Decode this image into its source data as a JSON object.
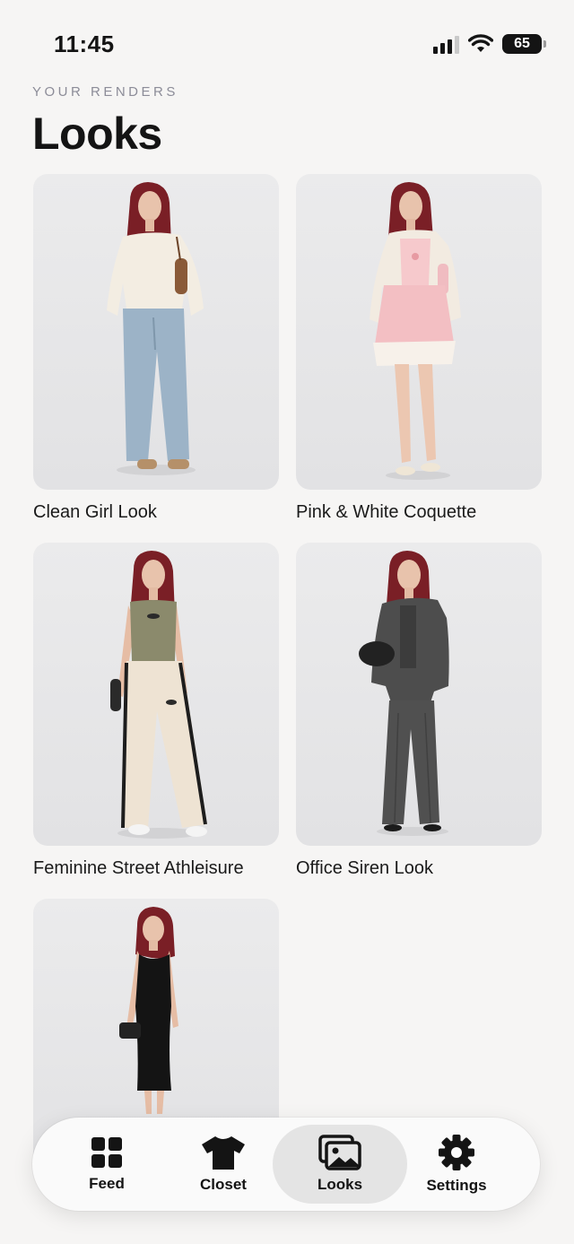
{
  "status_bar": {
    "time": "11:45",
    "battery": "65"
  },
  "header": {
    "eyebrow": "YOUR RENDERS",
    "title": "Looks"
  },
  "looks": [
    {
      "label": "Clean Girl Look"
    },
    {
      "label": "Pink & White Coquette"
    },
    {
      "label": "Feminine Street Athleisure"
    },
    {
      "label": "Office Siren Look"
    },
    {
      "label": ""
    }
  ],
  "tabbar": {
    "active": "Looks",
    "tabs": [
      {
        "label": "Feed",
        "icon": "grid-icon"
      },
      {
        "label": "Closet",
        "icon": "tshirt-icon"
      },
      {
        "label": "Looks",
        "icon": "images-icon"
      },
      {
        "label": "Settings",
        "icon": "gear-icon"
      }
    ]
  }
}
